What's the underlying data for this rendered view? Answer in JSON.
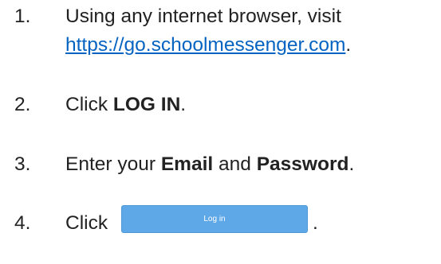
{
  "steps": [
    {
      "number": "1.",
      "text_before": "Using any internet browser, visit",
      "link_text": "https://go.schoolmessenger.com",
      "text_after": "."
    },
    {
      "number": "2.",
      "text_before": "Click ",
      "bold": "LOG IN",
      "text_after": "."
    },
    {
      "number": "3.",
      "text_before": "Enter your ",
      "bold1": "Email",
      "middle": " and ",
      "bold2": "Password",
      "text_after": "."
    },
    {
      "number": "4.",
      "text_before": "Click",
      "button_label": "Log in",
      "text_after": "."
    }
  ],
  "colors": {
    "link": "#0563c1",
    "button": "#5fa8e8",
    "text": "#222222"
  }
}
